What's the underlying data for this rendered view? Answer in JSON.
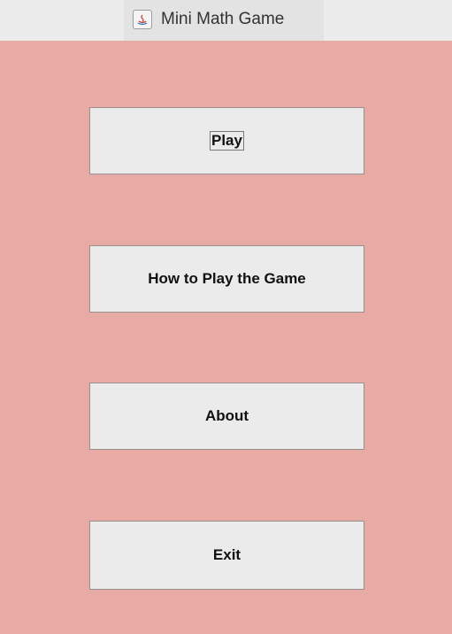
{
  "window": {
    "title": "Mini Math Game",
    "icon": "java-app-icon",
    "background_color": "#e8aaa4"
  },
  "menu": {
    "play_label": "Play",
    "how_to_play_label": "How to Play the Game",
    "about_label": "About",
    "exit_label": "Exit"
  }
}
